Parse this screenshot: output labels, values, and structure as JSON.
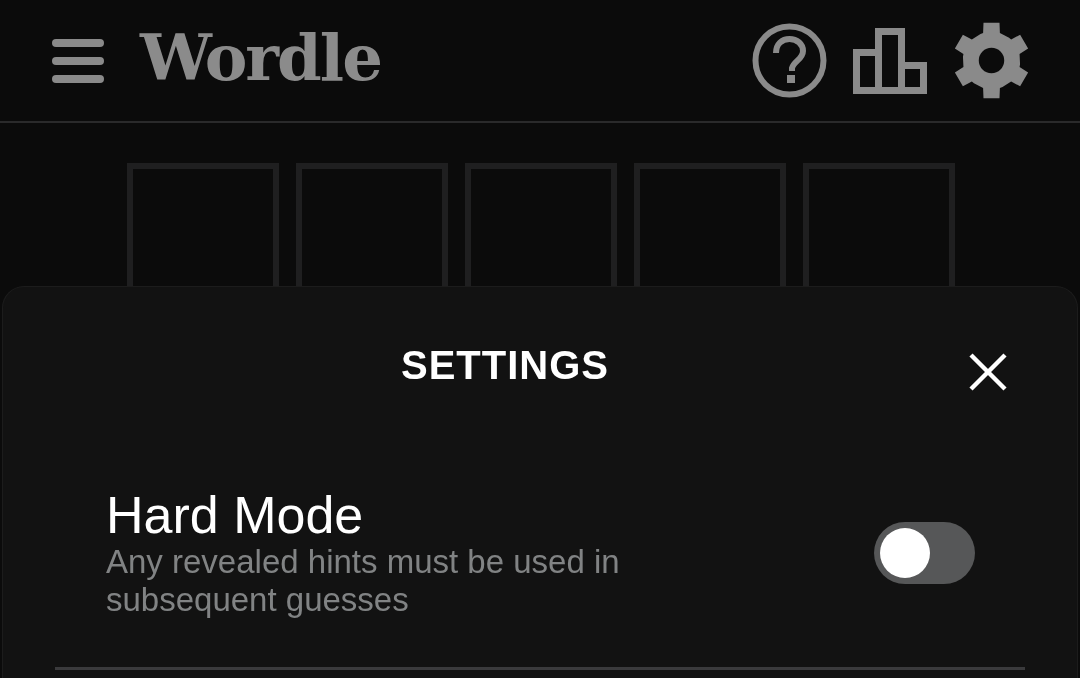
{
  "header": {
    "title": "Wordle"
  },
  "board": {
    "tiles": [
      {
        "kind": "empty"
      },
      {
        "kind": "empty"
      },
      {
        "kind": "empty"
      },
      {
        "kind": "empty"
      },
      {
        "kind": "empty"
      }
    ]
  },
  "settings": {
    "title": "SETTINGS",
    "options": [
      {
        "label": "Hard Mode",
        "description": "Any revealed hints must be used in subsequent guesses",
        "on": false
      }
    ]
  }
}
